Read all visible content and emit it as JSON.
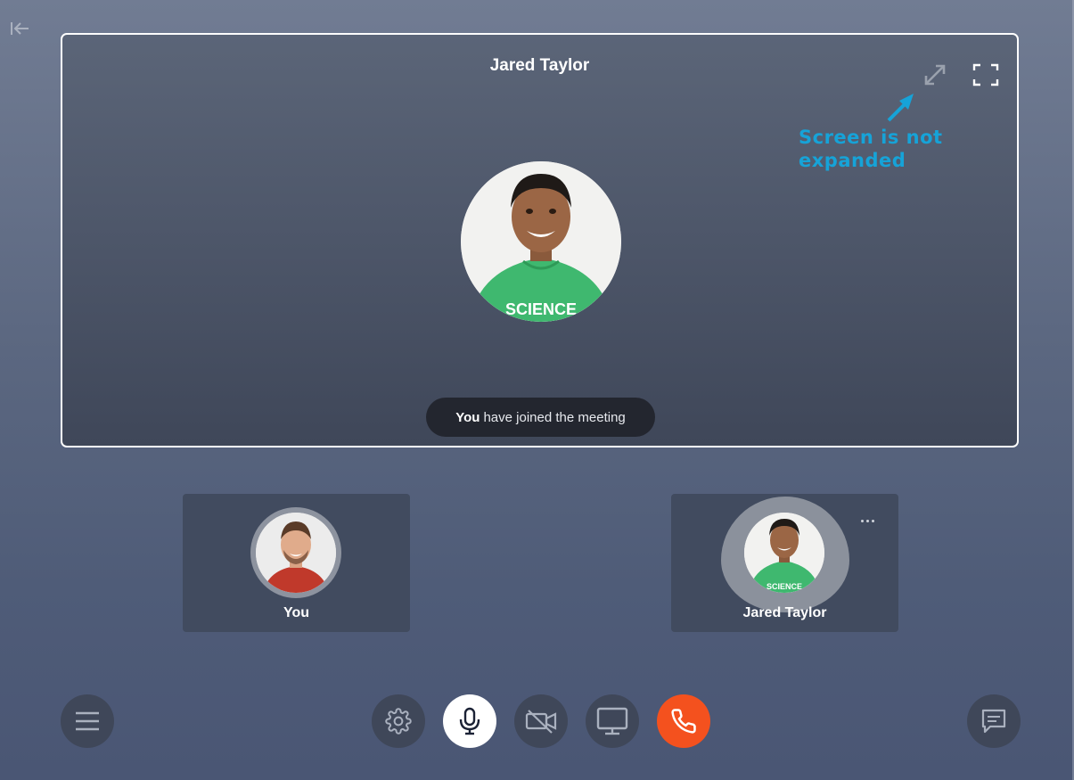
{
  "stage": {
    "participant_name": "Jared Taylor",
    "annotation": "Screen is not expanded",
    "toast_bold": "You",
    "toast_text": "have joined the meeting"
  },
  "tiles": [
    {
      "name": "You",
      "speaking": false
    },
    {
      "name": "Jared Taylor",
      "speaking": true
    }
  ],
  "controls": {
    "menu": "menu-icon",
    "settings": "gear-icon",
    "mic": "microphone-icon",
    "video": "video-off-icon",
    "share": "screen-share-icon",
    "hangup": "phone-icon",
    "chat": "chat-icon"
  },
  "colors": {
    "annotation": "#16a3d8",
    "hangup": "#f4511e",
    "toast_bg": "#23262f"
  }
}
